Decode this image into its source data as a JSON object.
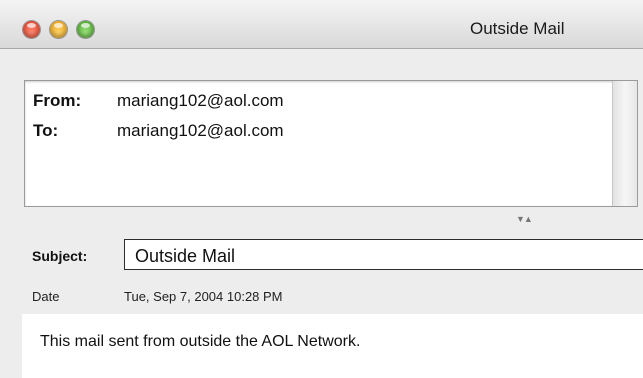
{
  "window": {
    "title": "Outside Mail"
  },
  "headers": {
    "from_label": "From:",
    "from_value": "mariang102@aol.com",
    "to_label": "To:",
    "to_value": "mariang102@aol.com"
  },
  "subject": {
    "label": "Subject:",
    "value": "Outside Mail"
  },
  "date": {
    "label": "Date",
    "value": "Tue, Sep 7, 2004 10:28 PM"
  },
  "body": {
    "text": "This mail sent from outside the AOL Network."
  },
  "colors": {
    "close": "#d8361f",
    "minimize": "#e59a0d",
    "zoom": "#3f9d1e",
    "window_bg": "#ededed"
  },
  "icons": [
    "close-button",
    "minimize-button",
    "zoom-button",
    "splitter-arrows-icon"
  ]
}
